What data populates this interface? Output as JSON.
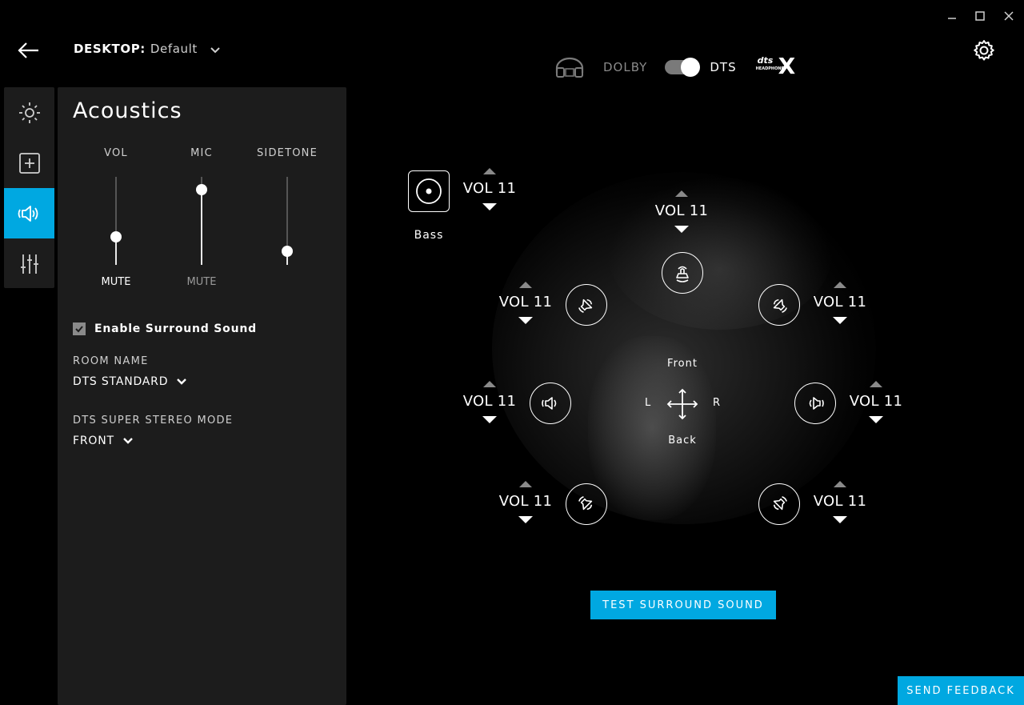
{
  "window": {
    "minimize_glyph": "—",
    "maximize_glyph": "☐",
    "close_glyph": "✕"
  },
  "header": {
    "profile_label": "DESKTOP:",
    "profile_value": "Default"
  },
  "audio_mode": {
    "left": "DOLBY",
    "right": "DTS",
    "selected": "DTS",
    "dts_logo_top": "dts",
    "dts_logo_sub": "HEADPHONE",
    "dts_logo_x": "X"
  },
  "panel": {
    "title": "Acoustics",
    "sliders": [
      {
        "label": "VOL",
        "value": 0.32,
        "mute_label": "MUTE"
      },
      {
        "label": "MIC",
        "value": 0.85,
        "mute_label": "MUTE"
      },
      {
        "label": "SIDETONE",
        "value": 0.15,
        "mute_label": ""
      }
    ],
    "surround_checkbox": {
      "label": "Enable Surround Sound",
      "checked": true
    },
    "room_name": {
      "label": "ROOM NAME",
      "value": "DTS STANDARD"
    },
    "stereo_mode": {
      "label": "DTS SUPER STEREO MODE",
      "value": "FRONT"
    }
  },
  "surround": {
    "bass": {
      "label": "Bass",
      "vol": "VOL 11"
    },
    "center": {
      "vol": "VOL 11"
    },
    "front_left": {
      "vol": "VOL 11"
    },
    "front_right": {
      "vol": "VOL 11"
    },
    "side_left": {
      "vol": "VOL 11"
    },
    "side_right": {
      "vol": "VOL 11"
    },
    "rear_left": {
      "vol": "VOL 11"
    },
    "rear_right": {
      "vol": "VOL 11"
    },
    "directions": {
      "front": "Front",
      "back": "Back",
      "left": "L",
      "right": "R"
    },
    "test_button": "TEST SURROUND SOUND"
  },
  "footer": {
    "feedback_button": "SEND FEEDBACK"
  },
  "colors": {
    "accent": "#00a8e1",
    "panel": "#1c1c1c",
    "background": "#000000"
  }
}
